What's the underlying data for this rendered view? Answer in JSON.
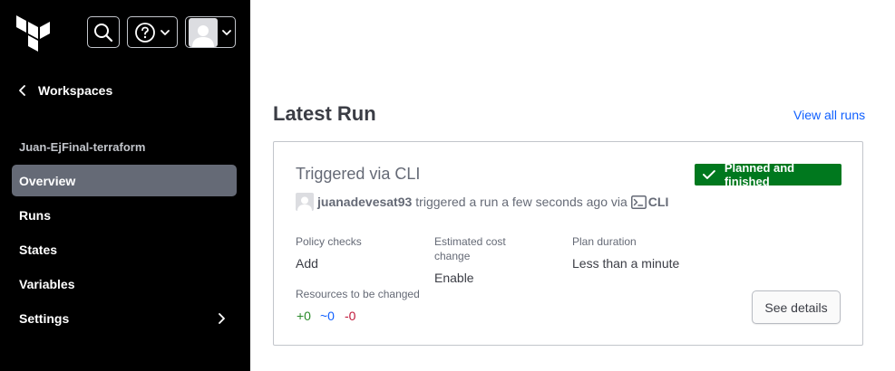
{
  "icons": {
    "logo": "terraform-logo",
    "search": "search-icon",
    "help": "help-circle-icon",
    "user": "user-avatar-icon",
    "back": "chevron-left-icon",
    "settings_expand": "chevron-right-icon",
    "status": "check-icon",
    "cli": "terminal-icon"
  },
  "colors": {
    "sidebar_bg": "#000000",
    "active_nav_bg": "#656a76",
    "link": "#1060ff",
    "status_success": "#00781e",
    "diff_add": "#2b8a2b",
    "diff_change": "#1060ff",
    "diff_destroy": "#c0183a"
  },
  "sidebar": {
    "back_label": "Workspaces",
    "workspace_name": "Juan-EjFinal-terraform",
    "nav": [
      {
        "label": "Overview",
        "active": true
      },
      {
        "label": "Runs",
        "active": false
      },
      {
        "label": "States",
        "active": false
      },
      {
        "label": "Variables",
        "active": false
      },
      {
        "label": "Settings",
        "active": false
      }
    ]
  },
  "main": {
    "section_title": "Latest Run",
    "view_all_label": "View all runs",
    "run": {
      "title": "Triggered via CLI",
      "status": "Planned and finished",
      "user": "juanadevesat93",
      "action_text": "triggered a run a few seconds ago via",
      "source": "CLI",
      "policy_checks_label": "Policy checks",
      "policy_checks_value": "Add",
      "cost_label": "Estimated cost change",
      "cost_value": "Enable",
      "duration_label": "Plan duration",
      "duration_value": "Less than a minute",
      "resources_label": "Resources to be changed",
      "add": "+0",
      "change": "~0",
      "destroy": "-0",
      "details_label": "See details"
    }
  }
}
